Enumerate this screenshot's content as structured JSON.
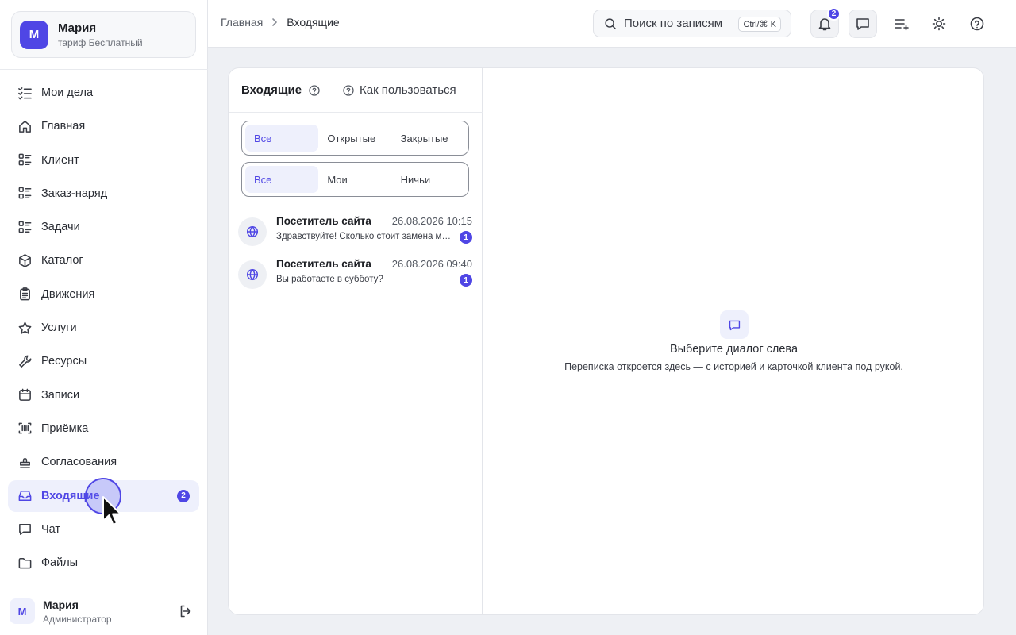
{
  "workspace": {
    "initial": "М",
    "name": "Мария",
    "plan": "тариф Бесплатный"
  },
  "sidebar": {
    "items": [
      {
        "label": "Мои дела",
        "icon": "checklist-icon"
      },
      {
        "label": "Главная",
        "icon": "home-icon"
      },
      {
        "label": "Клиент",
        "icon": "list-grid-icon"
      },
      {
        "label": "Заказ-наряд",
        "icon": "list-grid-icon"
      },
      {
        "label": "Задачи",
        "icon": "list-grid-icon"
      },
      {
        "label": "Каталог",
        "icon": "box-icon"
      },
      {
        "label": "Движения",
        "icon": "clipboard-icon"
      },
      {
        "label": "Услуги",
        "icon": "star-icon"
      },
      {
        "label": "Ресурсы",
        "icon": "wrench-icon"
      },
      {
        "label": "Записи",
        "icon": "calendar-icon"
      },
      {
        "label": "Приёмка",
        "icon": "barcode-scan-icon"
      },
      {
        "label": "Согласования",
        "icon": "stamp-icon"
      },
      {
        "label": "Входящие",
        "icon": "inbox-icon",
        "active": true,
        "badge": "2"
      },
      {
        "label": "Чат",
        "icon": "chat-icon"
      },
      {
        "label": "Файлы",
        "icon": "folder-icon"
      }
    ]
  },
  "user": {
    "initial": "М",
    "name": "Мария",
    "role": "Администратор"
  },
  "breadcrumb": {
    "home": "Главная",
    "current": "Входящие"
  },
  "search": {
    "placeholder": "Поиск по записям",
    "shortcut": "Ctrl/⌘ K"
  },
  "topbar": {
    "notifications_badge": "2"
  },
  "inbox": {
    "title": "Входящие",
    "howto": "Как пользоваться",
    "status_filter": [
      "Все",
      "Открытые",
      "Закрытые"
    ],
    "owner_filter": [
      "Все",
      "Мои",
      "Ничьи"
    ],
    "conversations": [
      {
        "name": "Посетитель сайта",
        "time": "26.08.2026 10:15",
        "preview": "Здравствуйте! Сколько стоит замена масла?",
        "unread": "1"
      },
      {
        "name": "Посетитель сайта",
        "time": "26.08.2026 09:40",
        "preview": "Вы работаете в субботу?",
        "unread": "1"
      }
    ]
  },
  "empty_state": {
    "title": "Выберите диалог слева",
    "subtitle": "Переписка откроется здесь — с историей и карточкой клиента под рукой."
  },
  "colors": {
    "accent": "#4f46e5",
    "accent_soft": "#eef0fc",
    "background": "#eef0f4"
  }
}
